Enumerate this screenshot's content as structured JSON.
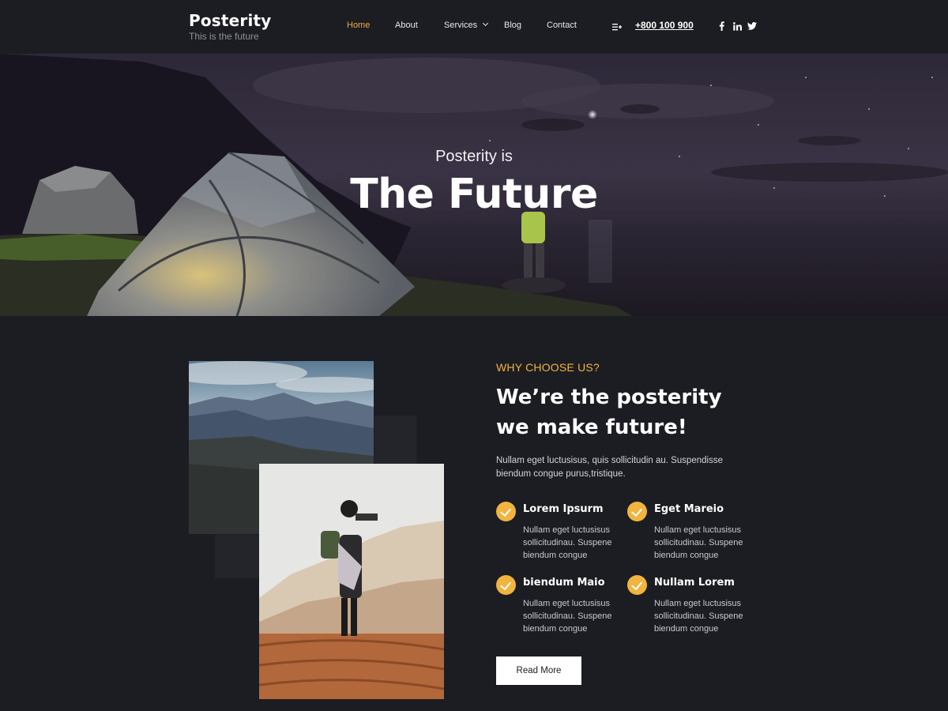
{
  "brand": {
    "name": "Posterity",
    "tagline": "This is the future"
  },
  "nav": {
    "items": [
      {
        "label": "Home",
        "active": true
      },
      {
        "label": "About"
      },
      {
        "label": "Services",
        "has_dropdown": true
      },
      {
        "label": "Blog"
      },
      {
        "label": "Contact"
      }
    ],
    "menu_icon": "menu-icon",
    "phone": "+800 100 900",
    "social": [
      {
        "icon": "facebook-icon",
        "glyph": "f"
      },
      {
        "icon": "linkedin-icon",
        "glyph": "in"
      },
      {
        "icon": "twitter-icon",
        "glyph": "twitter"
      }
    ]
  },
  "hero": {
    "subtitle": "Posterity is",
    "title": "The Future"
  },
  "about": {
    "eyebrow": "WHY CHOOSE US?",
    "heading_line1": "We’re the posterity",
    "heading_line2": "we make future!",
    "intro": "Nullam eget luctusisus, quis sollicitudin au. Suspendisse biendum congue purus,tristique.",
    "features": [
      {
        "title": "Lorem Ipsurm",
        "text": "Nullam eget luctusisus sollicitudinau. Suspene biendum congue"
      },
      {
        "title": "Eget Mareio",
        "text": "Nullam eget luctusisus sollicitudinau. Suspene biendum congue"
      },
      {
        "title": "biendum Maio",
        "text": "Nullam eget luctusisus sollicitudinau. Suspene biendum congue"
      },
      {
        "title": "Nullam Lorem",
        "text": "Nullam eget luctusisus sollicitudinau. Suspene biendum congue"
      }
    ],
    "cta_label": "Read More"
  },
  "colors": {
    "background": "#1c1d22",
    "accent": "#f1b43e",
    "nav_active": "#f1a93e",
    "text": "#ffffff"
  }
}
